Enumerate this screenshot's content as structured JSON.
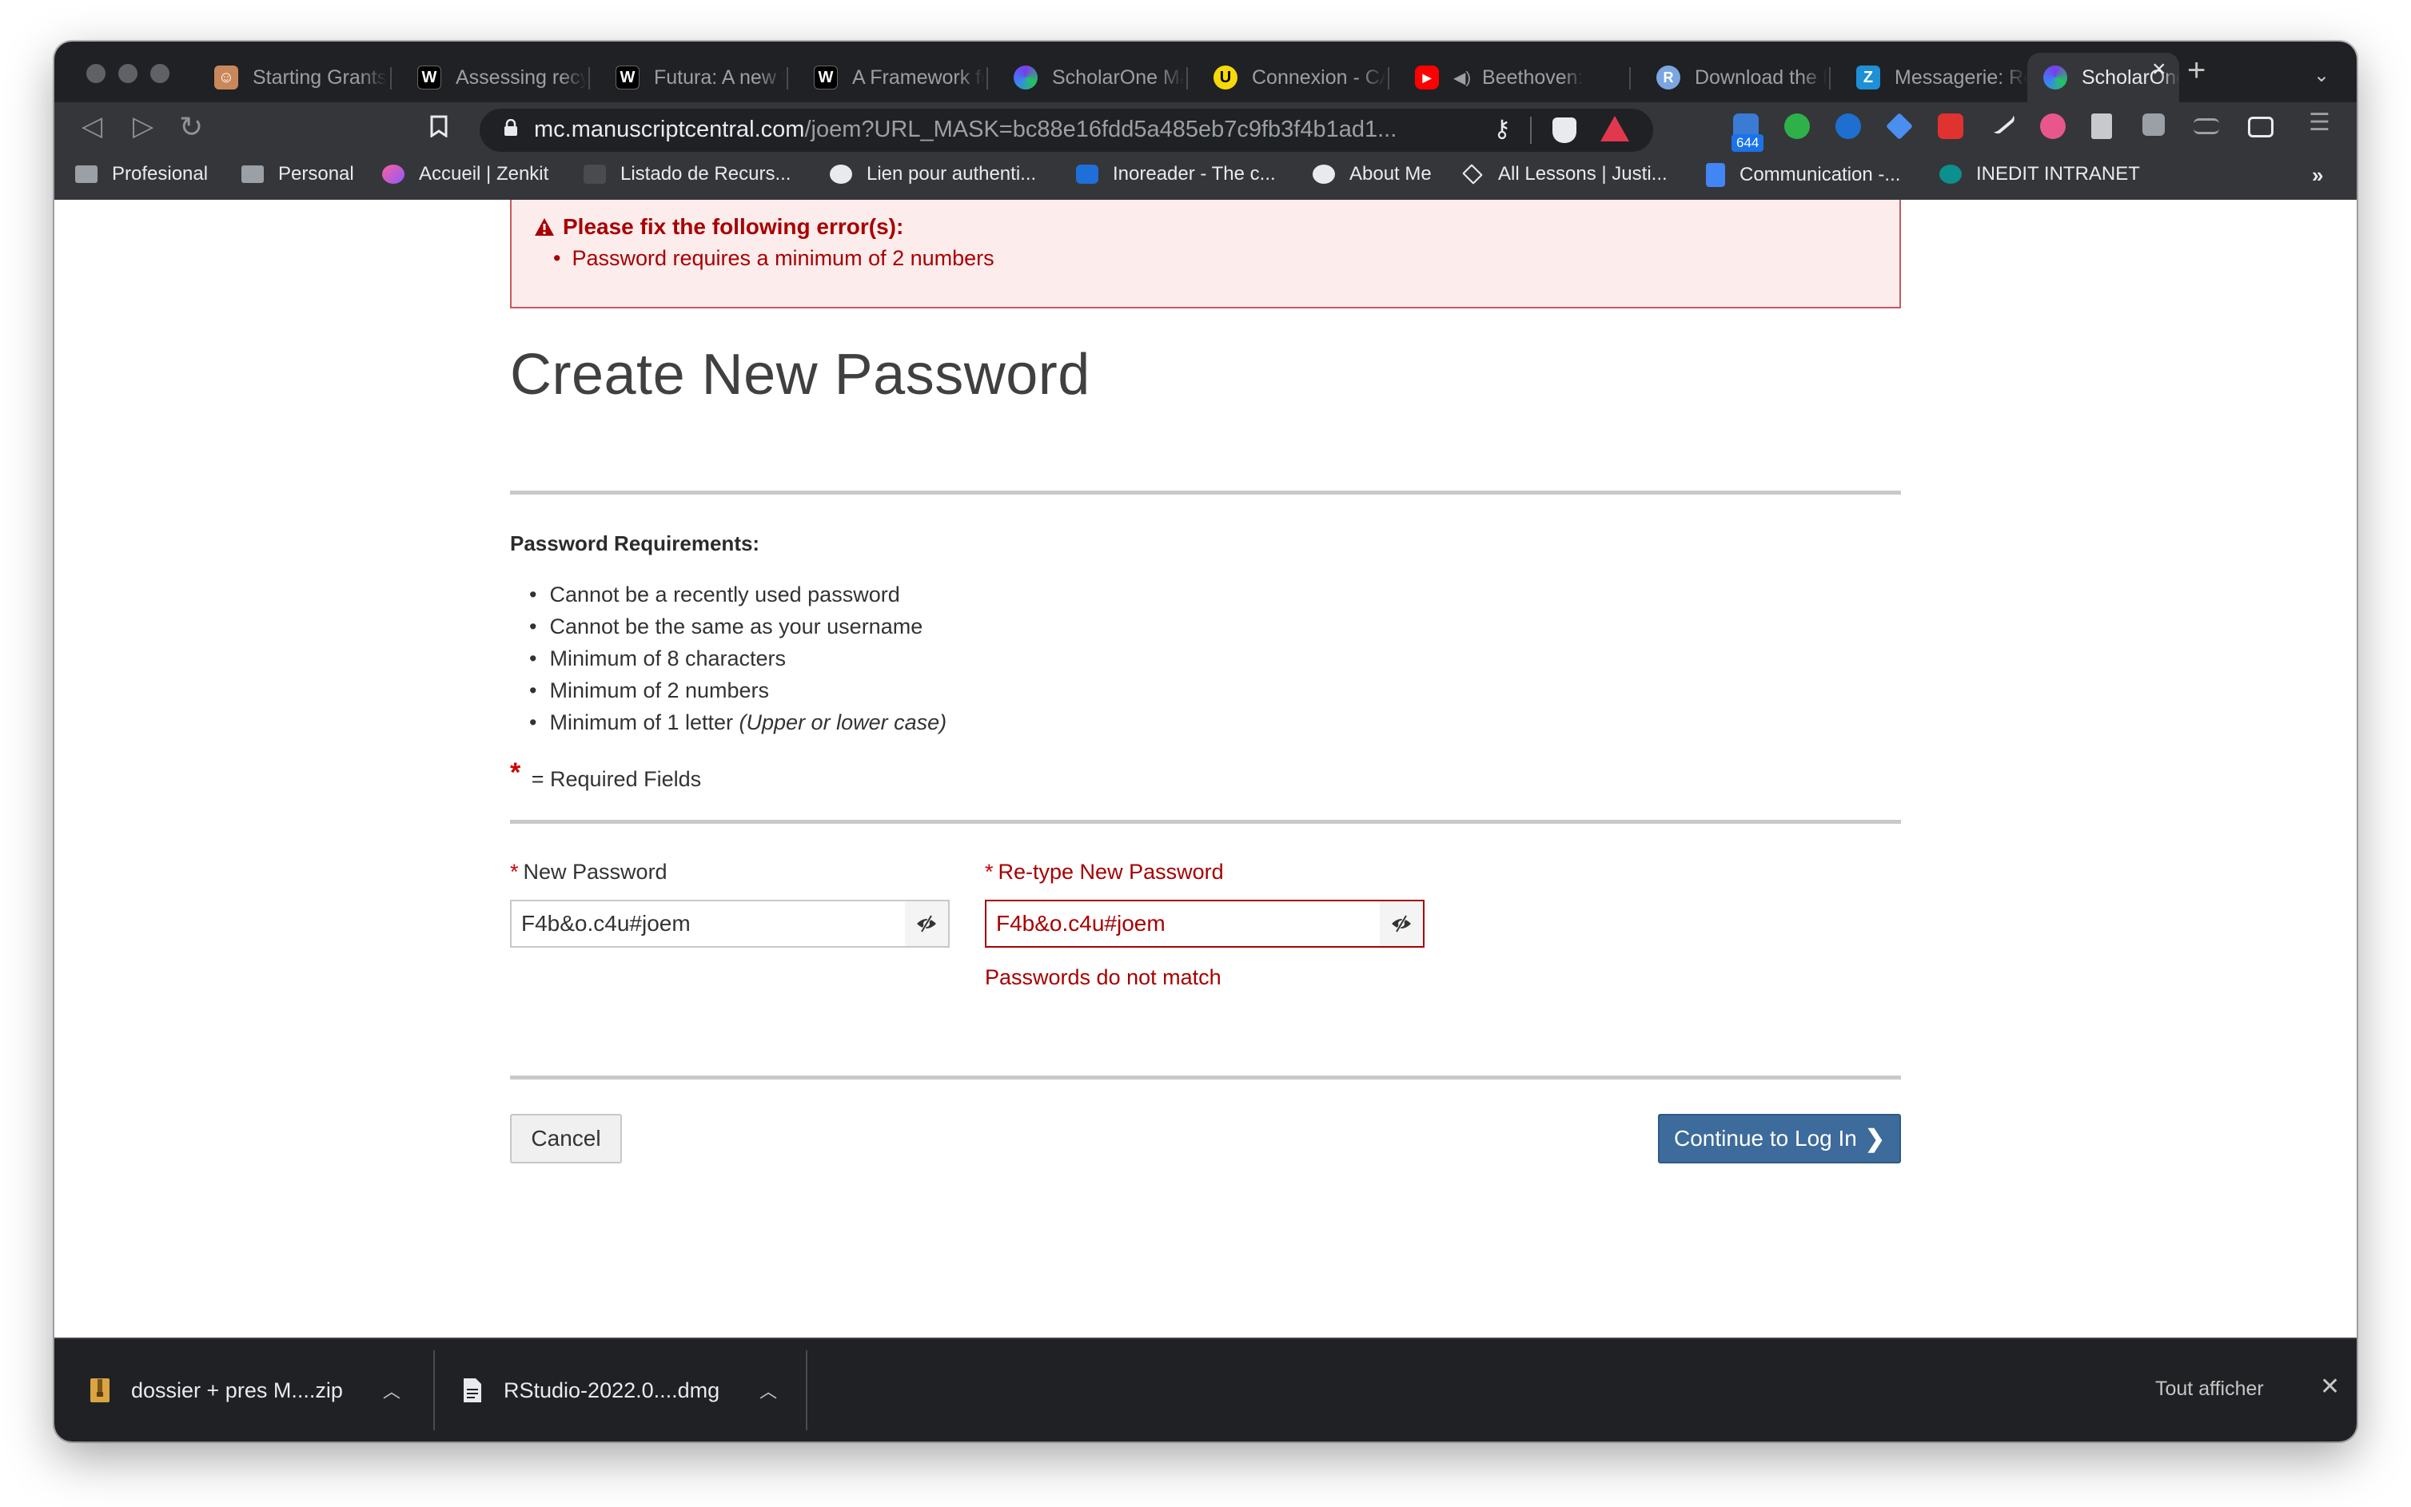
{
  "browser": {
    "tabs": [
      {
        "title": "Starting Grants",
        "favicon": "erc-icon",
        "active": false
      },
      {
        "title": "Assessing recycling",
        "favicon": "w-icon",
        "active": false
      },
      {
        "title": "Futura: A new t",
        "favicon": "w-icon",
        "active": false
      },
      {
        "title": "A Framework fo",
        "favicon": "w-icon",
        "active": false
      },
      {
        "title": "ScholarOne Ma",
        "favicon": "scholarone-icon",
        "active": false
      },
      {
        "title": "Connexion - CA",
        "favicon": "u-icon",
        "active": false
      },
      {
        "title": "Beethoven:",
        "favicon": "youtube-icon",
        "active": false
      },
      {
        "title": "Download the R",
        "favicon": "r-icon",
        "active": false
      },
      {
        "title": "Messagerie: Re",
        "favicon": "zimbra-icon",
        "active": false
      },
      {
        "title": "ScholarOne",
        "favicon": "scholarone-icon",
        "active": true
      }
    ],
    "url_host": "mc.manuscriptcentral.com",
    "url_path": "/joem?URL_MASK=bc88e16fdd5a485eb7c9fb3f4b1ad1...",
    "extension_badge": "644",
    "bookmarks": [
      {
        "label": "Profesional",
        "icon": "folder-icon"
      },
      {
        "label": "Personal",
        "icon": "folder-icon"
      },
      {
        "label": "Accueil | Zenkit",
        "icon": "zenkit-icon"
      },
      {
        "label": "Listado de Recurs...",
        "icon": "bookmark-icon"
      },
      {
        "label": "Lien pour authenti...",
        "icon": "globe-icon"
      },
      {
        "label": "Inoreader - The c...",
        "icon": "inoreader-icon"
      },
      {
        "label": "About Me",
        "icon": "globe-icon"
      },
      {
        "label": "All Lessons | Justi...",
        "icon": "lessons-icon"
      },
      {
        "label": "Communication -...",
        "icon": "docs-icon"
      },
      {
        "label": "INEDIT INTRANET",
        "icon": "sharepoint-icon"
      }
    ],
    "bookmarks_more": "»"
  },
  "page": {
    "error_title": "Please fix the following error(s):",
    "error_items": [
      "Password requires a minimum of 2 numbers"
    ],
    "title": "Create New Password",
    "requirements_heading": "Password Requirements:",
    "requirements": [
      "Cannot be a recently used password",
      "Cannot be the same as your username",
      "Minimum of 8 characters",
      "Minimum of 2 numbers",
      "Minimum of 1 letter "
    ],
    "requirement_note_italic": "(Upper or lower case)",
    "required_star": "*",
    "required_note": "= Required Fields",
    "new_password_label": "New Password",
    "new_password_value": "F4b&o.c4u#joem",
    "retype_label": "Re-type New Password",
    "retype_value": "F4b&o.c4u#joem",
    "mismatch_error": "Passwords do not match",
    "cancel_label": "Cancel",
    "continue_label": "Continue to Log In",
    "continue_chevron": "❯"
  },
  "downloads": {
    "items": [
      {
        "name": "dossier + pres M....zip",
        "icon": "zip-file-icon"
      },
      {
        "name": "RStudio-2022.0....dmg",
        "icon": "file-icon"
      }
    ],
    "show_all": "Tout afficher"
  },
  "colors": {
    "error_red": "#a80000",
    "error_bg": "#fdecec",
    "primary_button": "#3d6b9b",
    "browser_dark": "#202124"
  }
}
